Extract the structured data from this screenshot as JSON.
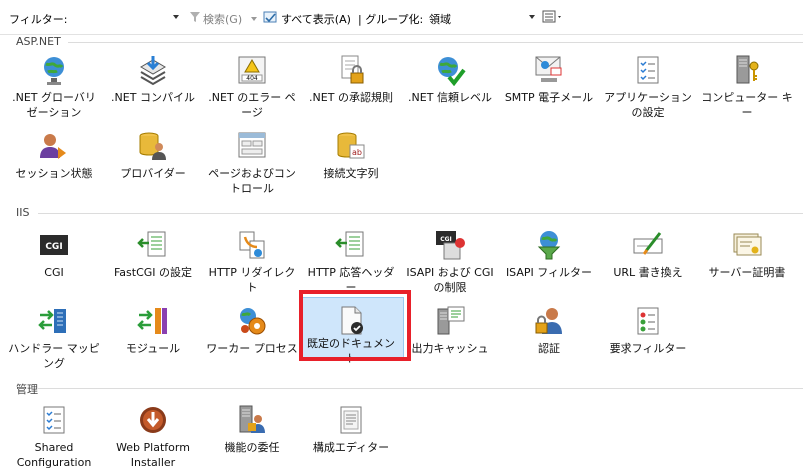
{
  "toolbar": {
    "filter_label": "フィルター:",
    "filter_value": "",
    "search_label": "検索(G)",
    "show_all_label": "すべて表示(A)",
    "group_by_label": "| グループ化:",
    "group_by_value": "領域"
  },
  "groups": {
    "aspnet": {
      "title": "ASP.NET",
      "items": [
        {
          "label": ".NET グローバリゼーション",
          "icon": "globe-icon"
        },
        {
          "label": ".NET コンパイル",
          "icon": "stack-download-icon"
        },
        {
          "label": ".NET のエラー ページ",
          "icon": "warning-404-icon"
        },
        {
          "label": ".NET の承認規則",
          "icon": "lock-document-icon"
        },
        {
          "label": ".NET 信頼レベル",
          "icon": "globe-check-icon"
        },
        {
          "label": "SMTP 電子メール",
          "icon": "mail-icon"
        },
        {
          "label": "アプリケーションの設定",
          "icon": "list-document-icon"
        },
        {
          "label": "コンピューター キー",
          "icon": "server-key-icon"
        },
        {
          "label": "セッション状態",
          "icon": "user-session-icon"
        },
        {
          "label": "プロバイダー",
          "icon": "database-users-icon"
        },
        {
          "label": "ページおよびコントロール",
          "icon": "form-icon"
        },
        {
          "label": "接続文字列",
          "icon": "database-ab-icon"
        }
      ]
    },
    "iis": {
      "title": "IIS",
      "items": [
        {
          "label": "CGI",
          "icon": "cgi-icon"
        },
        {
          "label": "FastCGI の設定",
          "icon": "fastcgi-icon"
        },
        {
          "label": "HTTP リダイレクト",
          "icon": "redirect-icon"
        },
        {
          "label": "HTTP 応答ヘッダー",
          "icon": "response-headers-icon"
        },
        {
          "label": "ISAPI および CGI の制限",
          "icon": "isapi-cgi-icon"
        },
        {
          "label": "ISAPI フィルター",
          "icon": "isapi-filter-icon"
        },
        {
          "label": "URL 書き換え",
          "icon": "url-rewrite-icon"
        },
        {
          "label": "サーバー証明書",
          "icon": "certificate-icon"
        },
        {
          "label": "ハンドラー マッピング",
          "icon": "handler-mapping-icon"
        },
        {
          "label": "モジュール",
          "icon": "modules-icon"
        },
        {
          "label": "ワーカー プロセス",
          "icon": "worker-process-icon"
        },
        {
          "label": "既定のドキュメント",
          "icon": "default-document-icon"
        },
        {
          "label": "出力キャッシュ",
          "icon": "output-cache-icon"
        },
        {
          "label": "認証",
          "icon": "authentication-icon"
        },
        {
          "label": "要求フィルター",
          "icon": "request-filter-icon"
        }
      ]
    },
    "management": {
      "title": "管理",
      "items": [
        {
          "label": "Shared Configuration",
          "icon": "shared-config-icon"
        },
        {
          "label": "Web Platform Installer",
          "icon": "web-platform-installer-icon"
        },
        {
          "label": "機能の委任",
          "icon": "feature-delegation-icon"
        },
        {
          "label": "構成エディター",
          "icon": "config-editor-icon"
        }
      ]
    }
  },
  "colors": {
    "selection_fill": "#cfe6fb",
    "selection_outline": "#e8202a"
  }
}
